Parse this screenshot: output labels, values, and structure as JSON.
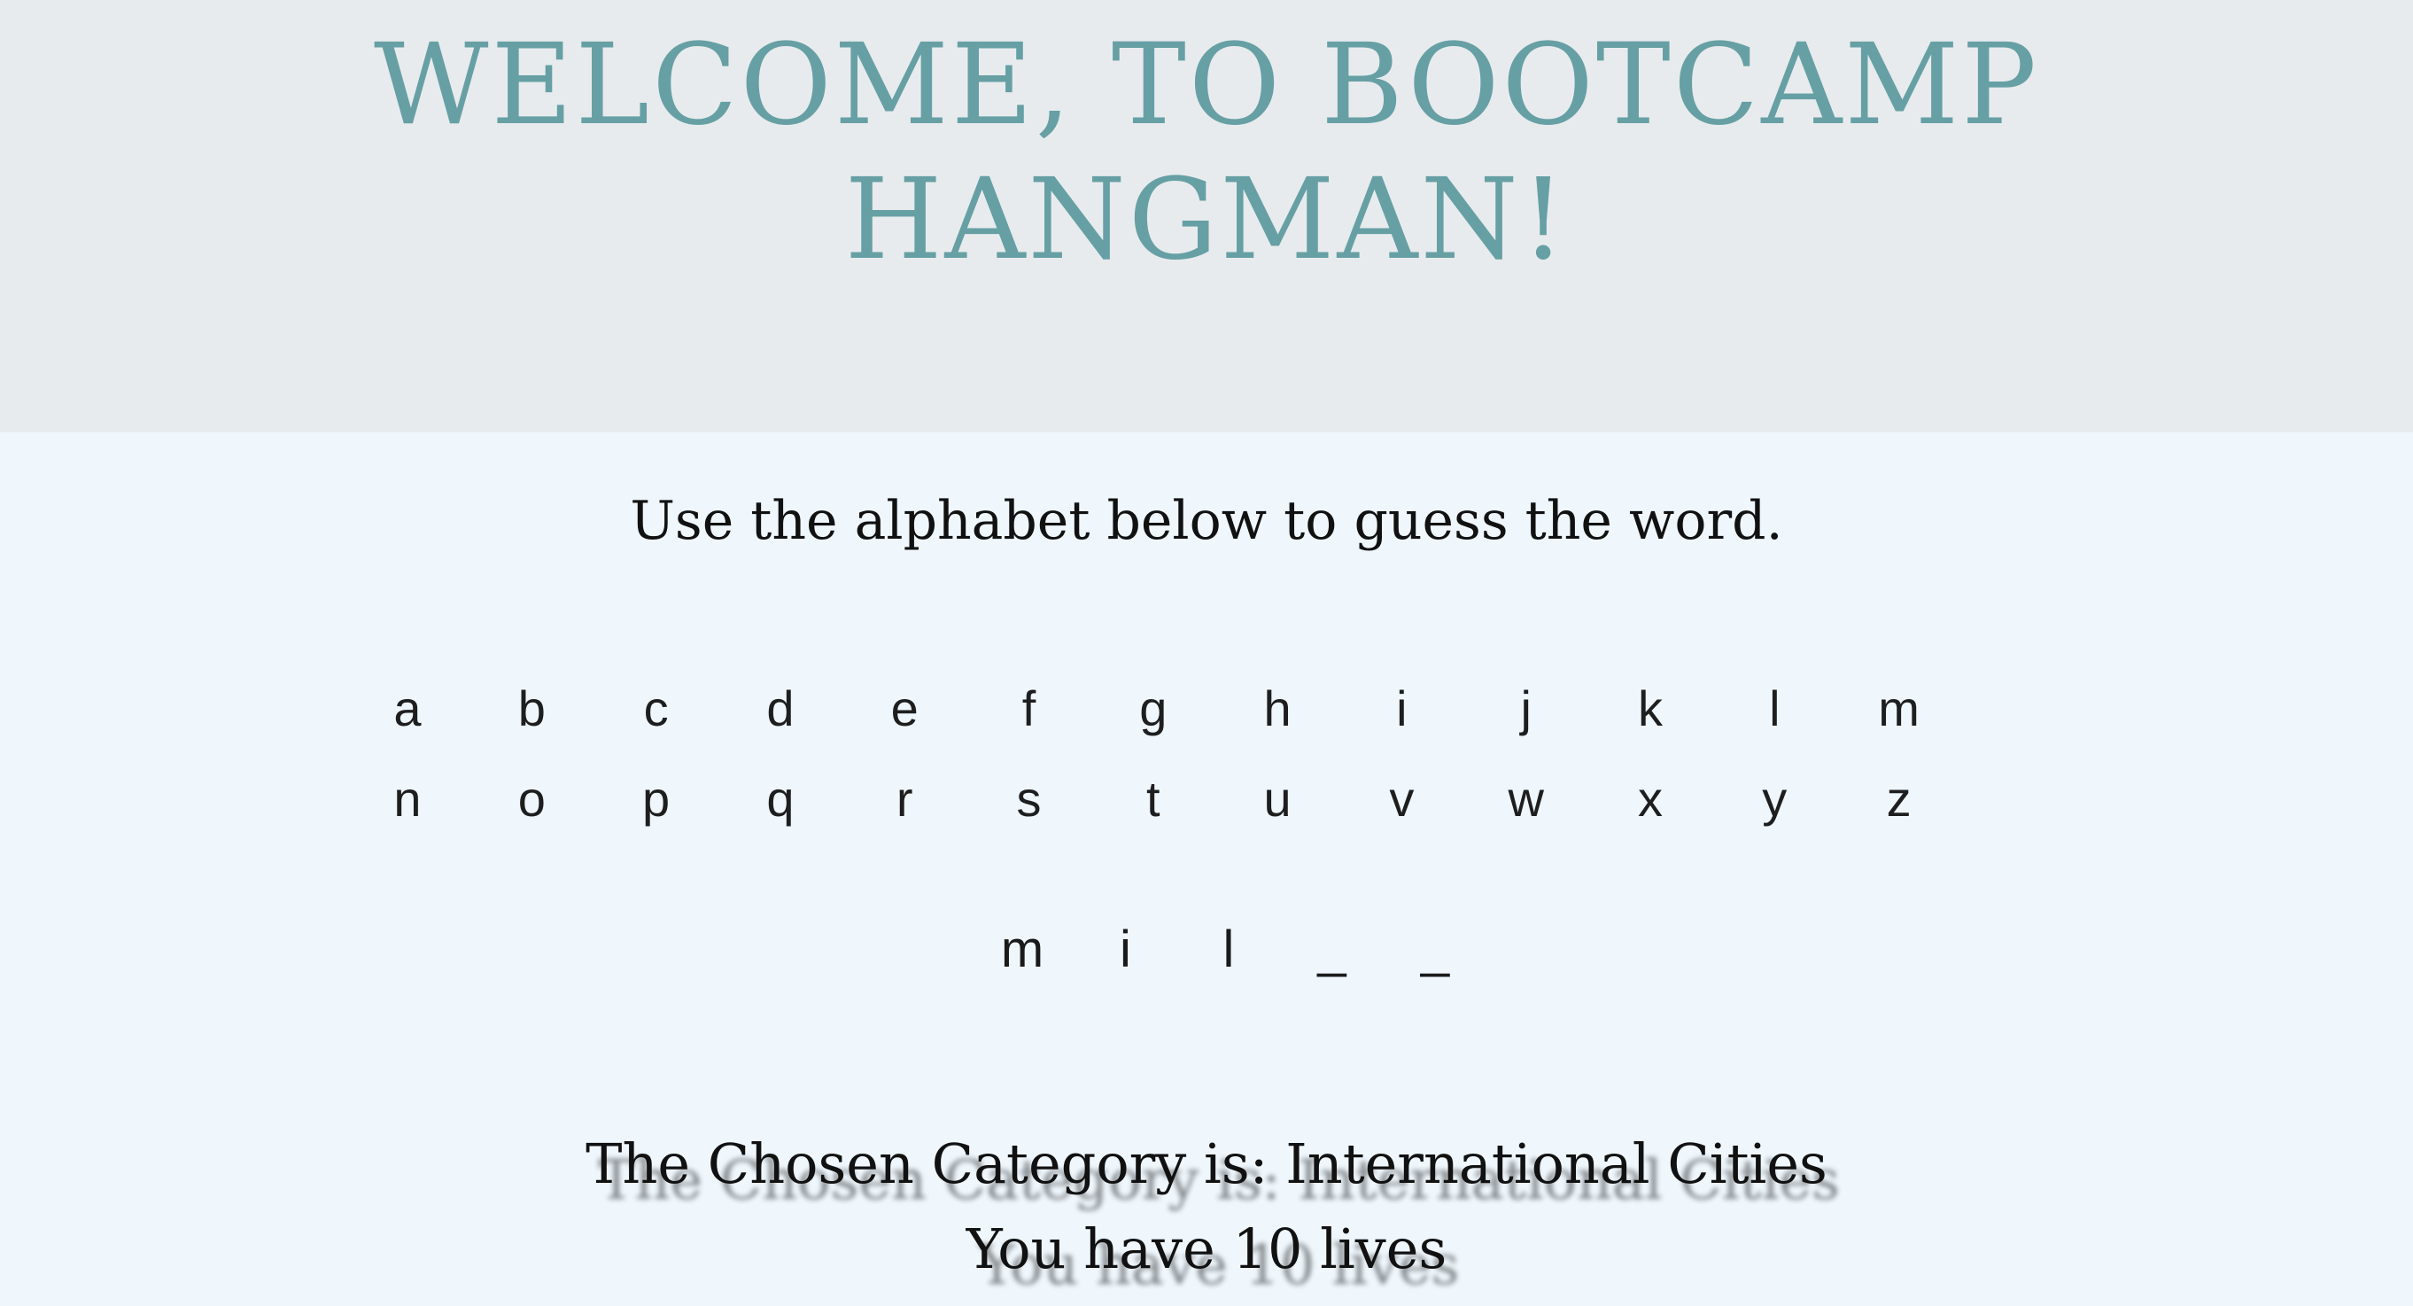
{
  "header": {
    "title_line1": "WELCOME, TO BOOTCAMP",
    "title_line2": "HANGMAN!"
  },
  "instructions": "Use the alphabet below to guess the word.",
  "alphabet": {
    "row1": [
      "a",
      "b",
      "c",
      "d",
      "e",
      "f",
      "g",
      "h",
      "i",
      "j",
      "k",
      "l",
      "m"
    ],
    "row2": [
      "n",
      "o",
      "p",
      "q",
      "r",
      "s",
      "t",
      "u",
      "v",
      "w",
      "x",
      "y",
      "z"
    ]
  },
  "word_display": [
    "m",
    "i",
    "l",
    "_",
    "_"
  ],
  "category_text": "The Chosen Category is: International Cities",
  "lives_text": "You have 10 lives",
  "colors": {
    "header_bg": "#e8ebee",
    "body_bg": "#eff7fd",
    "title": "#66a0a4"
  }
}
